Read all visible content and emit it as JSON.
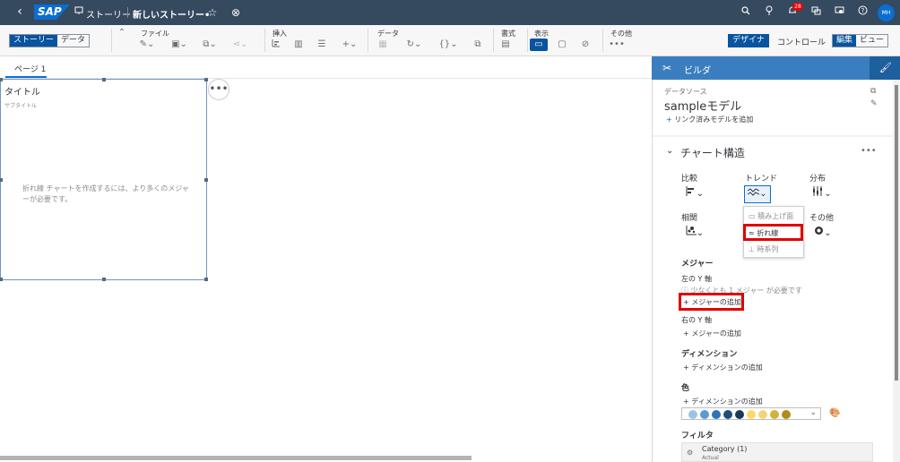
{
  "shell": {
    "back_icon": "chevron-left-icon",
    "logo": "SAP",
    "story_label": "ストーリー",
    "story_title": "新しいストーリー•",
    "notification_count": "28",
    "avatar": "MH"
  },
  "toolbar": {
    "story_tab": "ストーリー",
    "data_tab": "データ",
    "file": "ファイル",
    "insert": "挿入",
    "data": "データ",
    "format": "書式",
    "display": "表示",
    "other": "その他",
    "designer": "デザイナ",
    "control": "コントロール",
    "edit": "編集",
    "view": "ビュー"
  },
  "page": {
    "tab": "ページ 1"
  },
  "widget": {
    "title": "タイトル",
    "subtitle": "サブタイトル",
    "message": "折れ線 チャートを作成するには、より多くのメジャーが必要です。",
    "more": "•••"
  },
  "builder": {
    "header": "ビルダ",
    "datasource_label": "データソース",
    "model": "sampleモデル",
    "add_linked_model": "リンク済みモデルを追加",
    "chart_structure": "チャート構造",
    "comparison": "比較",
    "trend": "トレンド",
    "distribution": "分布",
    "correlation": "相関",
    "other": "その他",
    "dropdown": {
      "stacked_area": "積み上げ面",
      "line": "折れ線",
      "time_series": "時系列"
    },
    "measures": "メジャー",
    "left_y": "左の Y 軸",
    "left_warning": "少なくとも 1 メジャー が必要です",
    "add_measure": "メジャーの追加",
    "right_y": "右の Y 軸",
    "add_measure_right": "メジャーの追加",
    "dimensions": "ディメンション",
    "add_dimension": "ディメンションの追加",
    "color": "色",
    "add_color_dimension": "ディメンションの追加",
    "palette": [
      "#9cc3e5",
      "#5b9bd5",
      "#2e75b6",
      "#1f4e79",
      "#1b3a57",
      "#ffd966",
      "#f4d47a",
      "#d4b13c",
      "#b08c1a",
      "#7f6000"
    ],
    "filter": "フィルタ",
    "filter_item": "Category (1)",
    "filter_sub": "Actual"
  }
}
